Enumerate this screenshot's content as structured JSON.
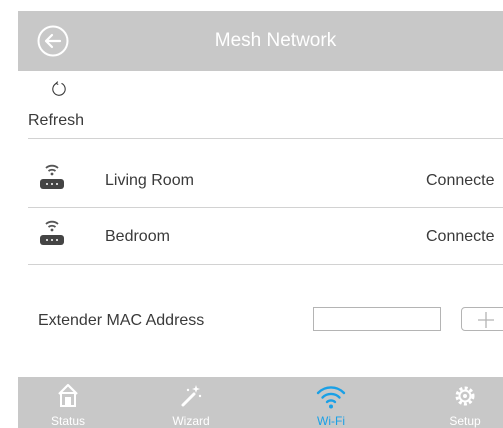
{
  "header": {
    "title": "Mesh Network"
  },
  "refresh": {
    "label": "Refresh"
  },
  "devices": [
    {
      "name": "Living Room",
      "status": "Connecte"
    },
    {
      "name": "Bedroom",
      "status": "Connecte"
    }
  ],
  "mac": {
    "label": "Extender MAC Address",
    "value": ""
  },
  "tabs": [
    {
      "label": "Status",
      "icon": "home-icon"
    },
    {
      "label": "Wizard",
      "icon": "magic-wand-icon"
    },
    {
      "label": "Wi-Fi",
      "icon": "wifi-icon",
      "active": true
    },
    {
      "label": "Setup",
      "icon": "gear-icon"
    }
  ],
  "colors": {
    "bar": "#c8c8c8",
    "active": "#1aa0e6",
    "text": "#3a3a3a"
  }
}
